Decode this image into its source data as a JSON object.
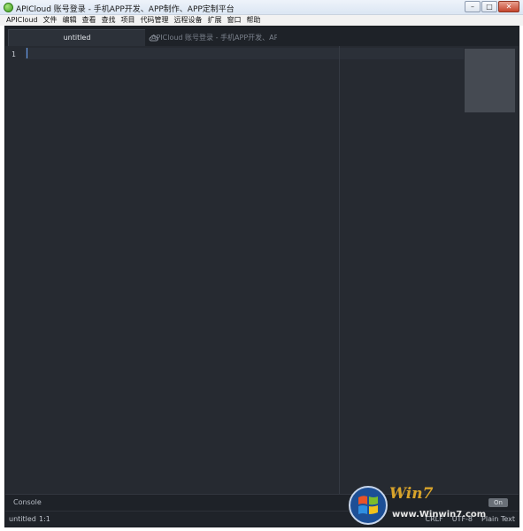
{
  "window": {
    "title": "APICloud 账号登录 - 手机APP开发、APP制作、APP定制平台",
    "controls": [
      "minimize",
      "maximize",
      "close"
    ]
  },
  "menubar": {
    "items": [
      "APICloud",
      "文件",
      "编辑",
      "查看",
      "查找",
      "项目",
      "代码管理",
      "远程设备",
      "扩展",
      "窗口",
      "帮助"
    ]
  },
  "tabs": [
    {
      "label": "untitled",
      "active": true
    },
    {
      "label": "APICloud 账号登录 - 手机APP开发、APP",
      "active": false,
      "icon": "cloud-icon"
    }
  ],
  "editor": {
    "line_numbers": [
      "1"
    ]
  },
  "console": {
    "label": "Console",
    "toggle_label": "On"
  },
  "statusbar": {
    "file": "untitled",
    "position": "1:1",
    "right": [
      "CRLF",
      "UTF-8",
      "Plain Text"
    ]
  },
  "watermark": {
    "brand": "Win7",
    "sub": "www.Winwin7.com"
  },
  "colors": {
    "editor_bg": "#262a31",
    "cursor": "#6fa8ff",
    "watermark_gold": "#d9a42a"
  }
}
